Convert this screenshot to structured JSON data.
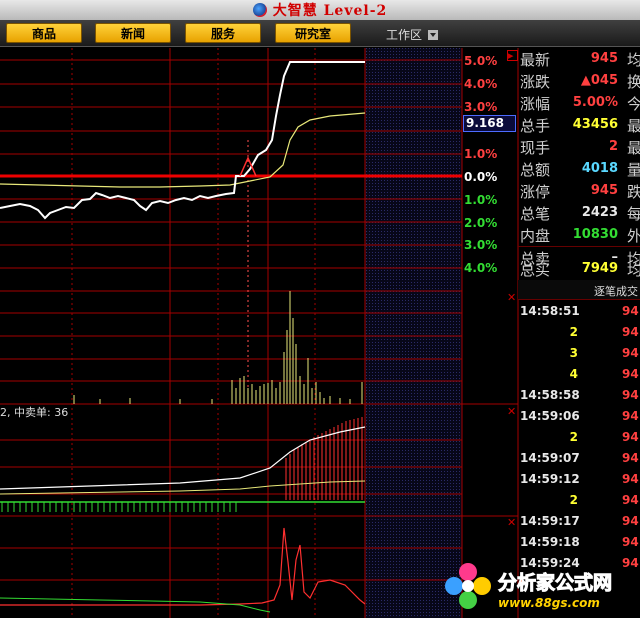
{
  "app": {
    "title": "大智慧 Level-2"
  },
  "menu": {
    "items": [
      "商品",
      "新闻",
      "服务",
      "研究室"
    ],
    "workspace": "工作区"
  },
  "axis": {
    "pct_labels": [
      "5.0%",
      "4.0%",
      "3.0%",
      "2.0%",
      "1.0%",
      "0.0%",
      "1.0%",
      "2.0%",
      "3.0%",
      "4.0%"
    ],
    "current_tag": "9.168"
  },
  "info": {
    "rows": [
      {
        "label": "最新",
        "value": "945",
        "tail": "均"
      },
      {
        "label": "涨跌",
        "value": "▲045",
        "tail": "换"
      },
      {
        "label": "涨幅",
        "value": "5.00%",
        "tail": "今"
      },
      {
        "label": "总手",
        "value": "43456",
        "tail": "最"
      },
      {
        "label": "现手",
        "value": "2",
        "tail": "最"
      },
      {
        "label": "总额",
        "value": "4018",
        "tail": "量"
      },
      {
        "label": "涨停",
        "value": "945",
        "tail": "跌"
      },
      {
        "label": "总笔",
        "value": "2423",
        "tail": "每"
      },
      {
        "label": "内盘",
        "value": "10830",
        "tail": "外"
      },
      {
        "label": "总卖",
        "value": "–",
        "tail": "均"
      },
      {
        "label": "总买",
        "value": "7949",
        "tail": "均"
      }
    ]
  },
  "trades": {
    "title": "逐笔成交",
    "rows": [
      {
        "time": "14:58:51",
        "qty": "",
        "price": "94"
      },
      {
        "time": "",
        "qty": "2",
        "price": "94"
      },
      {
        "time": "",
        "qty": "3",
        "price": "94"
      },
      {
        "time": "",
        "qty": "4",
        "price": "94"
      },
      {
        "time": "14:58:58",
        "qty": "",
        "price": "94"
      },
      {
        "time": "14:59:06",
        "qty": "",
        "price": "94"
      },
      {
        "time": "",
        "qty": "2",
        "price": "94"
      },
      {
        "time": "14:59:07",
        "qty": "",
        "price": "94"
      },
      {
        "time": "14:59:12",
        "qty": "",
        "price": "94"
      },
      {
        "time": "",
        "qty": "2",
        "price": "94"
      },
      {
        "time": "14:59:17",
        "qty": "",
        "price": "94"
      },
      {
        "time": "14:59:18",
        "qty": "",
        "price": "94"
      },
      {
        "time": "14:59:24",
        "qty": "",
        "price": "94"
      }
    ]
  },
  "indicator": {
    "label": "2, 中卖单: 36"
  },
  "watermark": {
    "text": "分析家公式网",
    "url": "www.88gs.com"
  },
  "colors": {
    "grid_red": "#a40000",
    "price_line": "#ffffff",
    "avg_line": "#e8e87a",
    "up": "#ff4040",
    "down": "#33dd33",
    "accent": "#ffff33"
  }
}
